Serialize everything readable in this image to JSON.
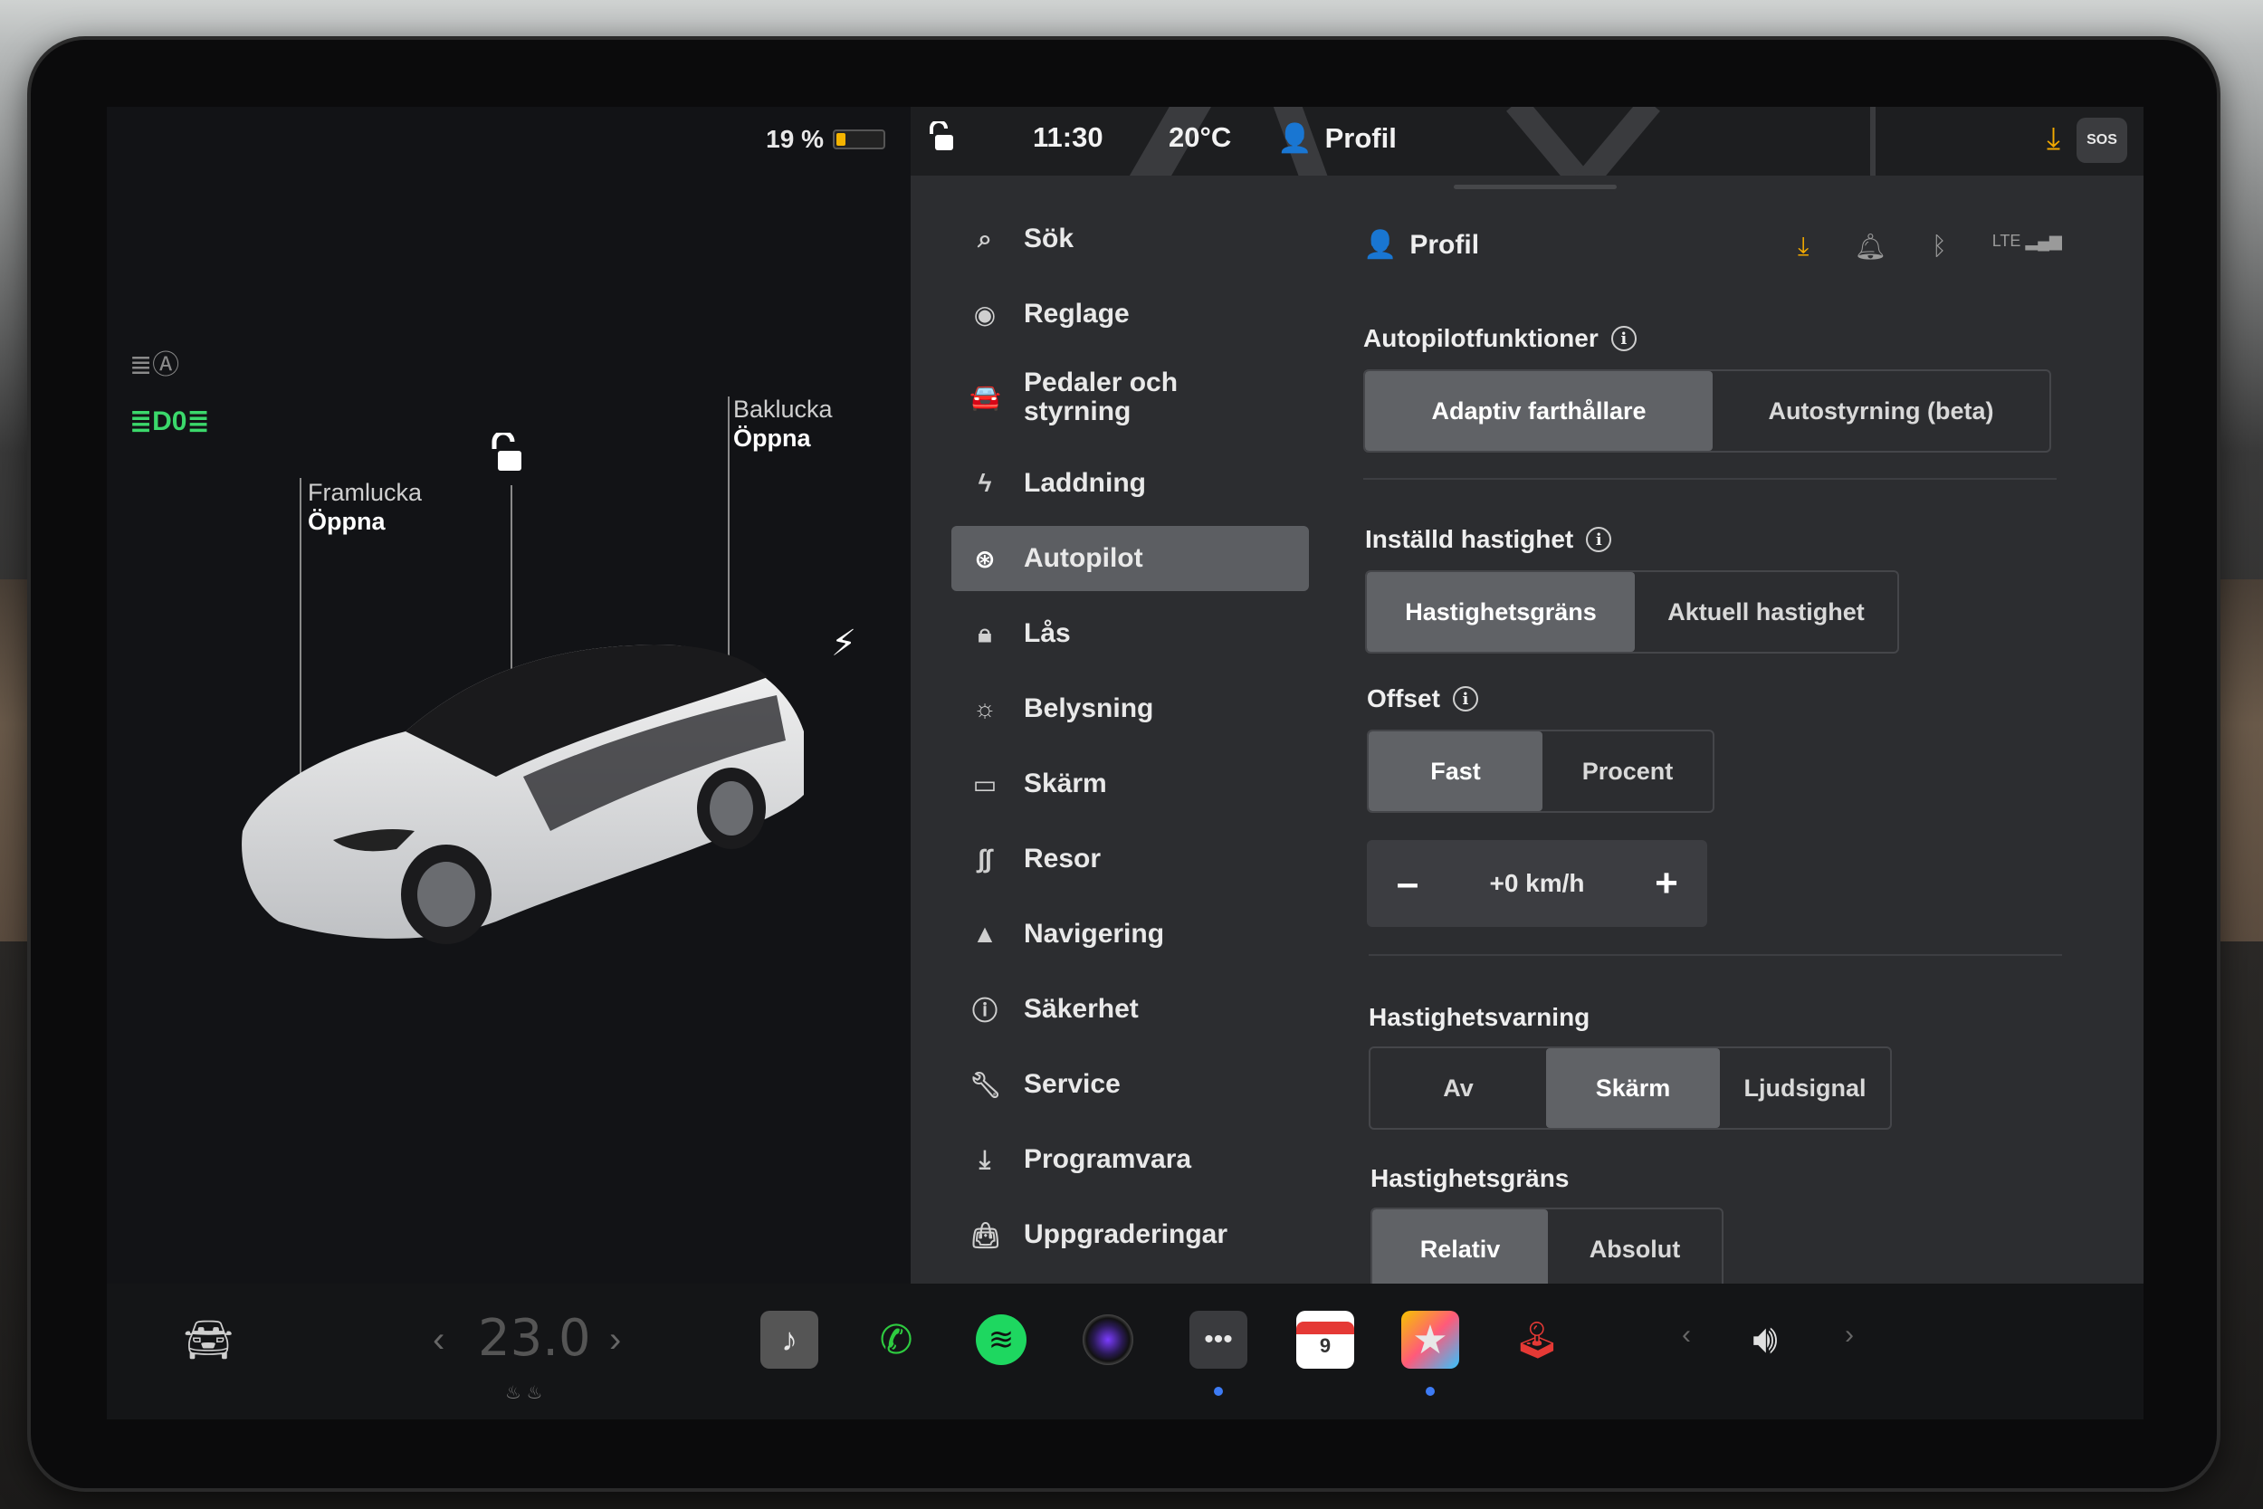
{
  "status": {
    "battery_percent_label": "19 %",
    "battery_level": 0.19,
    "time": "11:30",
    "temperature": "20°C",
    "profile": "Profil",
    "sos": "SOS"
  },
  "car": {
    "frunk": {
      "label": "Framlucka",
      "action": "Öppna"
    },
    "trunk": {
      "label": "Baklucka",
      "action": "Öppna"
    }
  },
  "menu": {
    "items": [
      {
        "label": "Sök",
        "icon": "search-icon"
      },
      {
        "label": "Reglage",
        "icon": "toggle-icon"
      },
      {
        "label": "Pedaler och styrning",
        "icon": "car-icon"
      },
      {
        "label": "Laddning",
        "icon": "bolt-icon"
      },
      {
        "label": "Autopilot",
        "icon": "steering-wheel-icon",
        "active": true
      },
      {
        "label": "Lås",
        "icon": "lock-icon"
      },
      {
        "label": "Belysning",
        "icon": "sun-icon"
      },
      {
        "label": "Skärm",
        "icon": "display-icon"
      },
      {
        "label": "Resor",
        "icon": "trips-icon"
      },
      {
        "label": "Navigering",
        "icon": "navigation-icon"
      },
      {
        "label": "Säkerhet",
        "icon": "safety-icon"
      },
      {
        "label": "Service",
        "icon": "wrench-icon"
      },
      {
        "label": "Programvara",
        "icon": "download-icon"
      },
      {
        "label": "Uppgraderingar",
        "icon": "bag-icon"
      }
    ]
  },
  "panel": {
    "header": "Profil",
    "lte": "LTE",
    "autopilot_features": {
      "title": "Autopilotfunktioner",
      "options": [
        "Adaptiv farthållare",
        "Autostyrning (beta)"
      ],
      "selected": 0
    },
    "set_speed": {
      "title": "Inställd hastighet",
      "options": [
        "Hastighetsgräns",
        "Aktuell hastighet"
      ],
      "selected": 0
    },
    "offset": {
      "title": "Offset",
      "options": [
        "Fast",
        "Procent"
      ],
      "selected": 0,
      "value": "+0 km/h"
    },
    "speed_warning": {
      "title": "Hastighetsvarning",
      "options": [
        "Av",
        "Skärm",
        "Ljudsignal"
      ],
      "selected": 1
    },
    "speed_limit": {
      "title": "Hastighetsgräns",
      "options": [
        "Relativ",
        "Absolut"
      ],
      "selected": 0
    }
  },
  "dock": {
    "temperature": "23.0",
    "calendar_day": "9"
  },
  "colors": {
    "accent_download": "#f2a900",
    "lights_green": "#3bd86b",
    "spotify_green": "#1ed760",
    "phone_green": "#2ecc40",
    "selected_segment": "#606266"
  }
}
